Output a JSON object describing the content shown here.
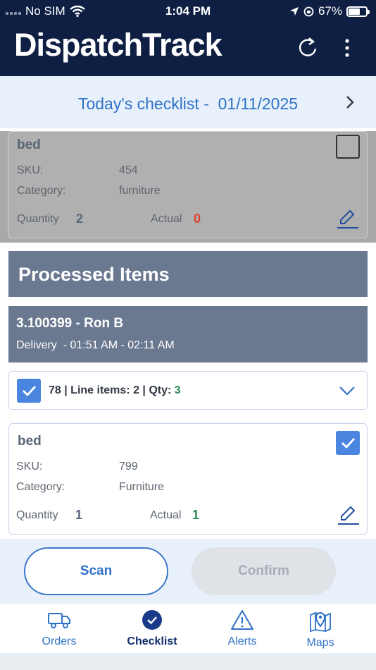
{
  "status_bar": {
    "carrier": "No SIM",
    "time": "1:04 PM",
    "battery": "67%",
    "battery_level": 0.67
  },
  "header": {
    "logo": "DispatchTrack",
    "refresh_icon": "refresh-icon",
    "menu_icon": "more-vertical-icon"
  },
  "checklist": {
    "label": "Today's checklist -",
    "date": "01/11/2025"
  },
  "pending_item": {
    "name": "bed",
    "sku_label": "SKU:",
    "sku": "454",
    "category_label": "Category:",
    "category": "furniture",
    "quantity_label": "Quantity",
    "quantity": "2",
    "actual_label": "Actual",
    "actual": "0",
    "checked": false
  },
  "processed": {
    "heading": "Processed Items",
    "order_id": "3.100399 - Ron B",
    "order_window": "Delivery  - 01:51 AM - 02:11 AM",
    "line_summary": "78 | Line items: 2 | Qty:",
    "line_qty": "3",
    "item": {
      "name": "bed",
      "sku_label": "SKU:",
      "sku": "799",
      "category_label": "Category:",
      "category": "Furniture",
      "quantity_label": "Quantity",
      "quantity": "1",
      "actual_label": "Actual",
      "actual": "1",
      "checked": true
    }
  },
  "actions": {
    "scan": "Scan",
    "confirm": "Confirm"
  },
  "tabs": [
    {
      "label": "Orders",
      "icon": "truck-icon",
      "active": false
    },
    {
      "label": "Checklist",
      "icon": "check-circle-icon",
      "active": true
    },
    {
      "label": "Alerts",
      "icon": "alert-triangle-icon",
      "active": false
    },
    {
      "label": "Maps",
      "icon": "map-pin-icon",
      "active": false
    }
  ],
  "colors": {
    "header": "#0f1f44",
    "accent": "#2f72c8",
    "section": "#6a7890",
    "success": "#2e8b57",
    "danger": "#e0412c"
  }
}
